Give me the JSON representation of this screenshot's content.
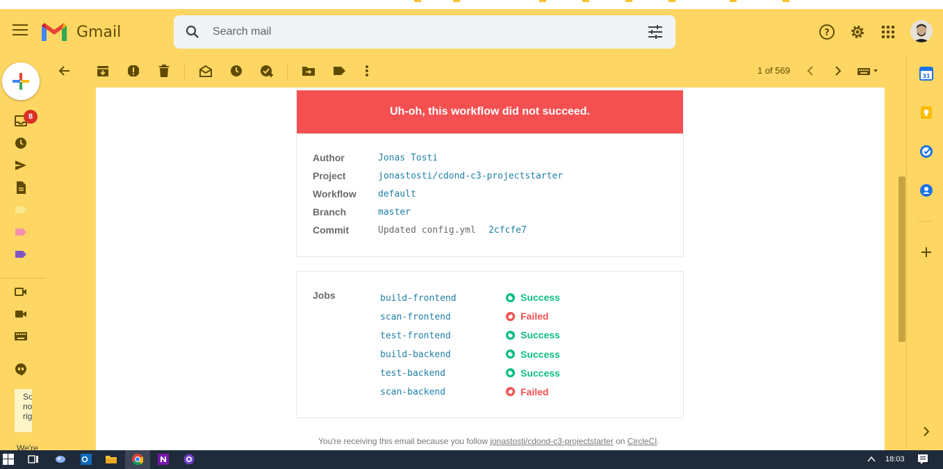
{
  "app": {
    "name": "Gmail"
  },
  "search": {
    "placeholder": "Search mail"
  },
  "rail": {
    "inbox_badge": "8",
    "notice_line1": "Somet",
    "notice_line2": "not",
    "notice_line3": "right.",
    "notice_line4": "We're"
  },
  "toolbar": {
    "page_count": "1 of 569"
  },
  "email": {
    "banner": "Uh-oh, this workflow did not succeed.",
    "info": [
      {
        "label": "Author",
        "value": "Jonas Tosti"
      },
      {
        "label": "Project",
        "value": "jonastosti/cdond-c3-projectstarter"
      },
      {
        "label": "Workflow",
        "value": "default"
      },
      {
        "label": "Branch",
        "value": "master"
      },
      {
        "label": "Commit",
        "value": "Updated config.yml",
        "hash": "2cfcfe7"
      }
    ],
    "jobs_label": "Jobs",
    "jobs": [
      {
        "name": "build-frontend",
        "status": "Success"
      },
      {
        "name": "scan-frontend",
        "status": "Failed"
      },
      {
        "name": "test-frontend",
        "status": "Success"
      },
      {
        "name": "build-backend",
        "status": "Success"
      },
      {
        "name": "test-backend",
        "status": "Success"
      },
      {
        "name": "scan-backend",
        "status": "Failed"
      }
    ],
    "footer": {
      "prefix": "You're receiving this email because you follow",
      "link": "jonastosti/cdond-c3-projectstarter",
      "middle": "on",
      "site": "CircleCI",
      "suffix": "."
    }
  },
  "side_panel": {
    "calendar_date": "31"
  },
  "taskbar": {
    "time": "18:03"
  },
  "colors": {
    "accent": "#fdd663",
    "banner": "#f55051",
    "success": "#0dbf82",
    "failed": "#f25050",
    "link": "#1f7fa6"
  }
}
